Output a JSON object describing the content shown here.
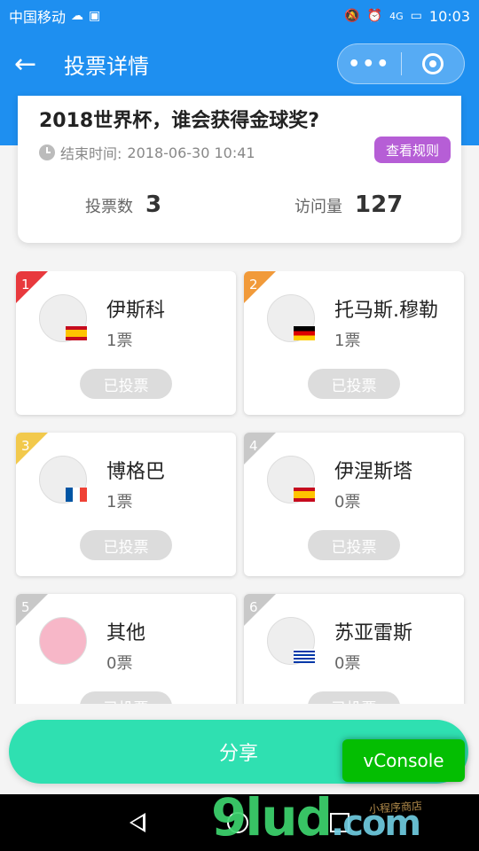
{
  "status_bar": {
    "carrier": "中国移动",
    "time": "10:03",
    "network": "4G"
  },
  "nav": {
    "title": "投票详情",
    "more_label": "•••"
  },
  "vote": {
    "title": "2018世界杯，谁会获得金球奖?",
    "end_label": "结束时间:",
    "end_time": "2018-06-30 10:41",
    "rules_label": "查看规则",
    "votes_label": "投票数",
    "votes_value": "3",
    "visits_label": "访问量",
    "visits_value": "127"
  },
  "candidates": [
    {
      "rank": "1",
      "name": "伊斯科",
      "votes": "1票",
      "button": "已投票",
      "rank_color": "#e8393d",
      "flag": "spain"
    },
    {
      "rank": "2",
      "name": "托马斯.穆勒",
      "votes": "1票",
      "button": "已投票",
      "rank_color": "#f19a3a",
      "flag": "germany"
    },
    {
      "rank": "3",
      "name": "博格巴",
      "votes": "1票",
      "button": "已投票",
      "rank_color": "#f2c94c",
      "flag": "france"
    },
    {
      "rank": "4",
      "name": "伊涅斯塔",
      "votes": "0票",
      "button": "已投票",
      "rank_color": "#c8c8c8",
      "flag": "spain"
    },
    {
      "rank": "5",
      "name": "其他",
      "votes": "0票",
      "button": "已投票",
      "rank_color": "#c8c8c8",
      "flag": "none"
    },
    {
      "rank": "6",
      "name": "苏亚雷斯",
      "votes": "0票",
      "button": "已投票",
      "rank_color": "#c8c8c8",
      "flag": "uruguay"
    }
  ],
  "share_label": "分享",
  "vconsole_label": "vConsole",
  "watermark": {
    "main": "9lud",
    "domain": ".com",
    "note": "小程序商店"
  },
  "colors": {
    "primary": "#1e8ff0",
    "share": "#2fe0b1",
    "rules": "#b65ed6",
    "vconsole": "#04be02"
  }
}
